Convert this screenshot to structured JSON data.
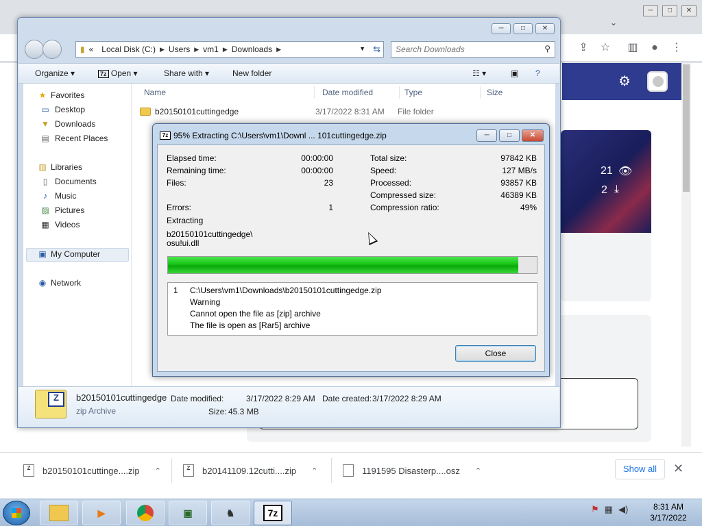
{
  "chrome": {
    "window_controls": [
      "─",
      "□",
      "✕"
    ],
    "stats": {
      "views": "21",
      "downloads": "2"
    }
  },
  "downloads_bar": {
    "items": [
      {
        "name": "b20150101cuttinge....zip",
        "icon": "7z-archive-icon"
      },
      {
        "name": "b20141109.12cutti....zip",
        "icon": "7z-archive-icon"
      },
      {
        "name": "1191595 Disasterp....osz",
        "icon": "file-icon"
      }
    ],
    "show_all": "Show all",
    "close": "✕"
  },
  "explorer": {
    "controls": [
      "─",
      "□",
      "✕"
    ],
    "breadcrumb": [
      "Local Disk (C:)",
      "Users",
      "vm1",
      "Downloads"
    ],
    "search_placeholder": "Search Downloads",
    "commands": {
      "organize": "Organize",
      "open": "Open",
      "share_with": "Share with",
      "new_folder": "New folder"
    },
    "nav": {
      "favorites": "Favorites",
      "desktop": "Desktop",
      "downloads": "Downloads",
      "recent_places": "Recent Places",
      "libraries": "Libraries",
      "documents": "Documents",
      "music": "Music",
      "pictures": "Pictures",
      "videos": "Videos",
      "my_computer": "My Computer",
      "network": "Network"
    },
    "columns": {
      "name": "Name",
      "date_modified": "Date modified",
      "type": "Type",
      "size": "Size"
    },
    "rows": [
      {
        "name": "b20150101cuttingedge",
        "date": "3/17/2022 8:31 AM",
        "type": "File folder"
      }
    ],
    "details": {
      "filename": "b20150101cuttingedge",
      "filetype": "zip Archive",
      "date_modified_label": "Date modified:",
      "date_modified": "3/17/2022 8:29 AM",
      "date_created_label": "Date created:",
      "date_created": "3/17/2022 8:29 AM",
      "size_label": "Size:",
      "size": "45.3 MB"
    }
  },
  "zip_dialog": {
    "logo": "7z",
    "title": "95% Extracting C:\\Users\\vm1\\Downl ... 101cuttingedge.zip",
    "controls": [
      "─",
      "□",
      "✕"
    ],
    "left": {
      "elapsed_label": "Elapsed time:",
      "elapsed": "00:00:00",
      "remaining_label": "Remaining time:",
      "remaining": "00:00:00",
      "files_label": "Files:",
      "files": "23",
      "errors_label": "Errors:",
      "errors": "1"
    },
    "right": {
      "total_label": "Total size:",
      "total": "97842 KB",
      "speed_label": "Speed:",
      "speed": "127 MB/s",
      "processed_label": "Processed:",
      "processed": "93857 KB",
      "compressed_label": "Compressed size:",
      "compressed": "46389 KB",
      "ratio_label": "Compression ratio:",
      "ratio": "49%"
    },
    "status": "Extracting",
    "current_path": "b20150101cuttingedge\\",
    "current_file": "osu!ui.dll",
    "progress": 0.95,
    "messages": {
      "index": "1",
      "path": "C:\\Users\\vm1\\Downloads\\b20150101cuttingedge.zip",
      "line1": "Warning",
      "line2": "Cannot open the file as [zip] archive",
      "line3": "The file is open as [Rar5] archive"
    },
    "close_button": "Close"
  },
  "taskbar": {
    "apps": [
      "explorer",
      "media-player",
      "chrome",
      "network-tool",
      "chess",
      "7-zip"
    ],
    "seven_zip_label": "7z",
    "time": "8:31 AM",
    "date": "3/17/2022"
  }
}
